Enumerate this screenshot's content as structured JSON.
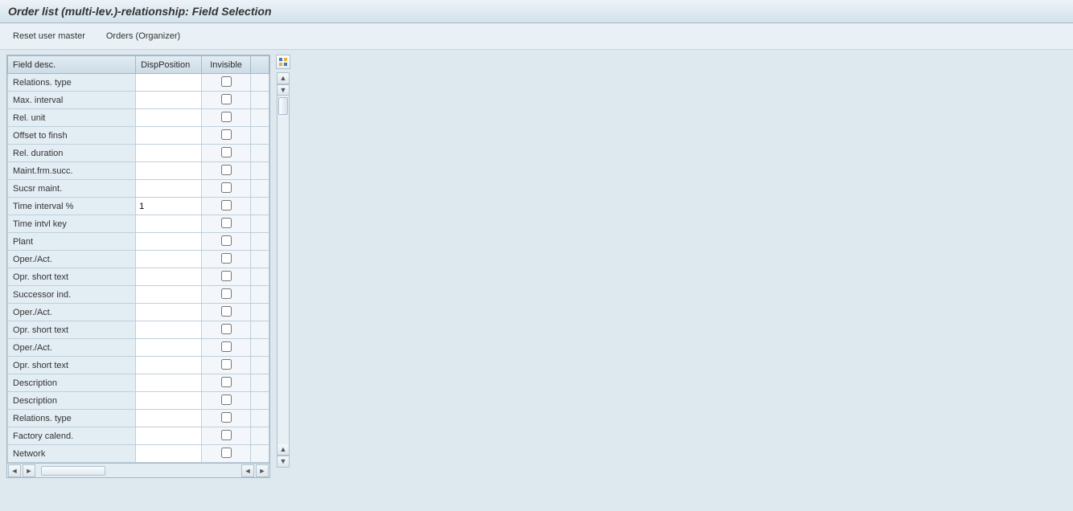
{
  "title": "Order list (multi-lev.)-relationship: Field Selection",
  "toolbar": {
    "reset_label": "Reset user master",
    "orders_label": "Orders (Organizer)"
  },
  "table": {
    "headers": {
      "field": "Field desc.",
      "pos": "DispPosition",
      "inv": "Invisible"
    },
    "rows": [
      {
        "field": "Relations. type",
        "pos": "",
        "inv": false
      },
      {
        "field": "Max. interval",
        "pos": "",
        "inv": false
      },
      {
        "field": "Rel. unit",
        "pos": "",
        "inv": false
      },
      {
        "field": "Offset to finsh",
        "pos": "",
        "inv": false
      },
      {
        "field": "Rel. duration",
        "pos": "",
        "inv": false
      },
      {
        "field": "Maint.frm.succ.",
        "pos": "",
        "inv": false
      },
      {
        "field": "Sucsr maint.",
        "pos": "",
        "inv": false
      },
      {
        "field": "Time interval %",
        "pos": "1",
        "inv": false
      },
      {
        "field": "Time intvl key",
        "pos": "",
        "inv": false
      },
      {
        "field": "Plant",
        "pos": "",
        "inv": false
      },
      {
        "field": "Oper./Act.",
        "pos": "",
        "inv": false
      },
      {
        "field": "Opr. short text",
        "pos": "",
        "inv": false
      },
      {
        "field": "Successor ind.",
        "pos": "",
        "inv": false
      },
      {
        "field": "Oper./Act.",
        "pos": "",
        "inv": false
      },
      {
        "field": "Opr. short text",
        "pos": "",
        "inv": false
      },
      {
        "field": "Oper./Act.",
        "pos": "",
        "inv": false
      },
      {
        "field": "Opr. short text",
        "pos": "",
        "inv": false
      },
      {
        "field": "Description",
        "pos": "",
        "inv": false
      },
      {
        "field": "Description",
        "pos": "",
        "inv": false
      },
      {
        "field": "Relations. type",
        "pos": "",
        "inv": false
      },
      {
        "field": "Factory calend.",
        "pos": "",
        "inv": false
      },
      {
        "field": "Network",
        "pos": "",
        "inv": false
      }
    ]
  }
}
